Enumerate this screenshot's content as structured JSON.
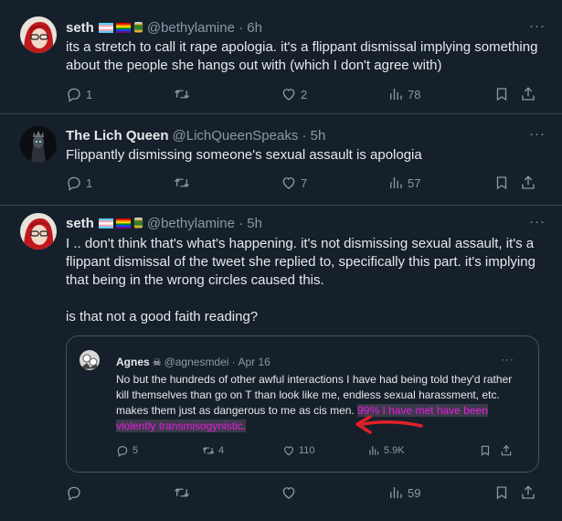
{
  "colors": {
    "bg": "#15202b",
    "muted": "#8b98a5",
    "text": "#e7e9ea",
    "highlight": "#e81ce0",
    "arrow": "#e0202a"
  },
  "tweets": [
    {
      "name": "seth",
      "handle": "@bethylamine · 6h",
      "text": "its a stretch to call it rape apologia. it's a flippant dismissal implying something about the people she hangs out with (which I don't agree with)",
      "replies": "1",
      "retweets": "",
      "likes": "2",
      "views": "78"
    },
    {
      "name": "The Lich Queen",
      "handle": "@LichQueenSpeaks · 5h",
      "text": "Flippantly dismissing someone's sexual assault is apologia",
      "replies": "1",
      "retweets": "",
      "likes": "7",
      "views": "57"
    },
    {
      "name": "seth",
      "handle": "@bethylamine · 5h",
      "text": "I .. don't think that's what's happening. it's not dismissing sexual assault, it's a flippant dismissal of the tweet she replied to, specifically this part. it's implying that being in the wrong circles caused this.\n\nis that not a good faith reading?",
      "replies": "",
      "retweets": "",
      "likes": "",
      "views": "59"
    }
  ],
  "quote": {
    "name": "Agnes",
    "handle": "@agnesmdei · Apr 16",
    "text_plain": "No but the hundreds of other awful interactions I have had being told they'd rather kill themselves than go on T than look like me, endless sexual harassment, etc. makes them just as dangerous to me as cis men. ",
    "text_highlight": "99% I have met have been violently transmisogynistic.",
    "replies": "5",
    "retweets": "4",
    "likes": "110",
    "views": "5.9K"
  },
  "icons": [
    "reply-icon",
    "retweet-icon",
    "like-icon",
    "views-icon",
    "bookmark-icon",
    "share-icon"
  ]
}
